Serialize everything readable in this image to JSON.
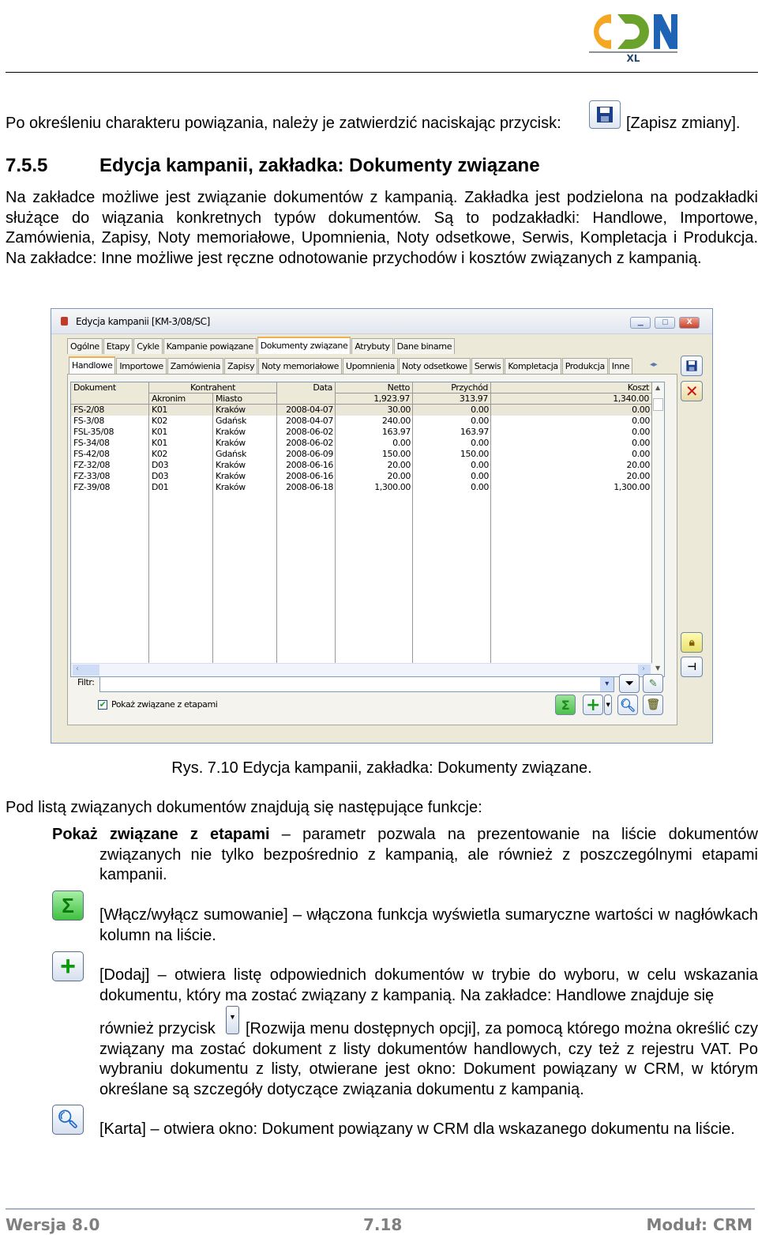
{
  "logo": {
    "text": "CDN",
    "sub": "XL",
    "colors": [
      "#f5a623",
      "#6aa22c",
      "#1f64b4"
    ]
  },
  "intro": {
    "text": "Po określeniu charakteru powiązania, należy je zatwierdzić naciskając przycisk:",
    "after": "[Zapisz zmiany].",
    "icon": "save-icon"
  },
  "section": {
    "number": "7.5.5",
    "title": "Edycja kampanii, zakładka: Dokumenty związane"
  },
  "paragraph": "Na zakładce możliwe jest związanie dokumentów z kampanią. Zakładka jest podzielona na podzakładki służące do wiązania konkretnych typów dokumentów. Są to podzakładki: Handlowe, Importowe, Zamówienia, Zapisy, Noty memoriałowe, Upomnienia, Noty odsetkowe, Serwis, Kompletacja i Produkcja. Na zakładce: Inne możliwe jest ręczne odnotowanie przychodów i kosztów związanych z kampanią.",
  "window": {
    "title": "Edycja kampanii [KM-3/08/SC]",
    "tabs": [
      "Ogólne",
      "Etapy",
      "Cykle",
      "Kampanie powiązane",
      "Dokumenty związane",
      "Atrybuty",
      "Dane binarne"
    ],
    "active_tab": "Dokumenty związane",
    "subtabs": [
      "Handlowe",
      "Importowe",
      "Zamówienia",
      "Zapisy",
      "Noty memoriałowe",
      "Upomnienia",
      "Noty odsetkowe",
      "Serwis",
      "Kompletacja",
      "Produkcja",
      "Inne"
    ],
    "active_subtab": "Handlowe",
    "table": {
      "headers": {
        "dokument": "Dokument",
        "kontrahent": "Kontrahent",
        "akronim": "Akronim",
        "miasto": "Miasto",
        "data": "Data",
        "netto": "Netto",
        "przychod": "Przychód",
        "koszt": "Koszt"
      },
      "totals": {
        "netto": "1,923.97",
        "przychod": "313.97",
        "koszt": "1,340.00"
      },
      "rows": [
        [
          "FS-2/08",
          "K01",
          "Kraków",
          "2008-04-07",
          "30.00",
          "0.00",
          "0.00"
        ],
        [
          "FS-3/08",
          "K02",
          "Gdańsk",
          "2008-04-07",
          "240.00",
          "0.00",
          "0.00"
        ],
        [
          "FSL-35/08",
          "K01",
          "Kraków",
          "2008-06-02",
          "163.97",
          "163.97",
          "0.00"
        ],
        [
          "FS-34/08",
          "K01",
          "Kraków",
          "2008-06-02",
          "0.00",
          "0.00",
          "0.00"
        ],
        [
          "FS-42/08",
          "K02",
          "Gdańsk",
          "2008-06-09",
          "150.00",
          "150.00",
          "0.00"
        ],
        [
          "FZ-32/08",
          "D03",
          "Kraków",
          "2008-06-16",
          "20.00",
          "0.00",
          "20.00"
        ],
        [
          "FZ-33/08",
          "D03",
          "Kraków",
          "2008-06-16",
          "20.00",
          "0.00",
          "20.00"
        ],
        [
          "FZ-39/08",
          "D01",
          "Kraków",
          "2008-06-18",
          "1,300.00",
          "0.00",
          "1,300.00"
        ]
      ]
    },
    "filter_label": "Filtr:",
    "filter_value": "",
    "checkbox": {
      "label": "Pokaż związane z etapami",
      "checked": true
    }
  },
  "caption": "Rys. 7.10 Edycja kampanii, zakładka: Dokumenty związane.",
  "list_intro": "Pod listą związanych dokumentów znajdują się następujące funkcje:",
  "items": [
    {
      "bold": "Pokaż związane z etapami",
      "text": " – parametr pozwala na prezentowanie na liście dokumentów związanych nie tylko bezpośrednio z kampanią, ale również z poszczególnymi etapami kampanii."
    },
    {
      "icon": "sigma-icon",
      "text": "[Włącz/wyłącz sumowanie] – włączona funkcja wyświetla sumaryczne wartości w nagłówkach kolumn na liście."
    },
    {
      "icon": "plus-icon",
      "text": "[Dodaj] – otwiera listę odpowiednich dokumentów w trybie do wyboru, w celu wskazania dokumentu, który ma zostać związany z kampanią. Na zakładce: Handlowe znajduje się",
      "text2a": "również przycisk",
      "text2b": "[Rozwija menu dostępnych opcji], za pomocą którego można określić czy związany ma zostać dokument z listy dokumentów handlowych, czy też z rejestru VAT. Po wybraniu dokumentu z listy, otwierane jest okno: Dokument powiązany w CRM, w którym określane są szczegóły dotyczące związania dokumentu z kampanią."
    },
    {
      "icon": "magnifier-icon",
      "text": "[Karta] – otwiera okno: Dokument powiązany w CRM dla wskazanego dokumentu na liście."
    }
  ],
  "footer": {
    "left": "Wersja 8.0",
    "center": "7.18",
    "right": "Moduł: CRM"
  }
}
